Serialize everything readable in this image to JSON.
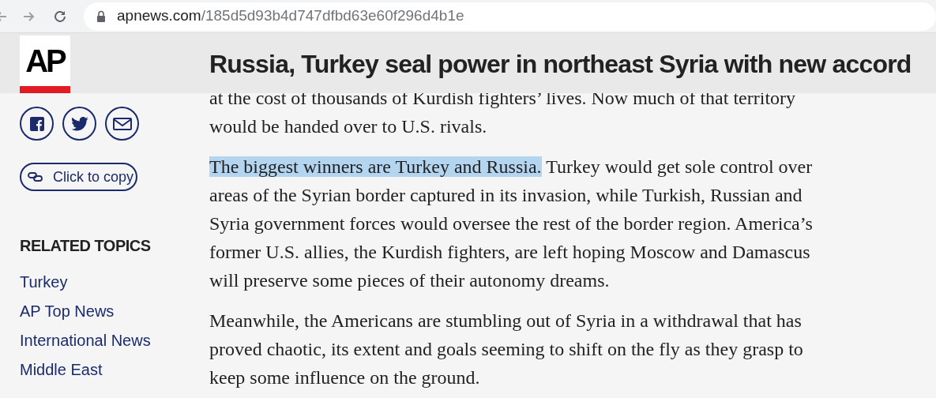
{
  "browser": {
    "domain": "apnews.com",
    "path": "/185d5d93b4d747dfbd63e60f296d4b1e"
  },
  "header": {
    "logo": "AP",
    "headline": "Russia, Turkey seal power in northeast Syria with new accord"
  },
  "share": {
    "copy_label": "Click to copy"
  },
  "related_topics": {
    "title": "RELATED TOPICS",
    "items": [
      "Turkey",
      "AP Top News",
      "International News",
      "Middle East"
    ]
  },
  "article": {
    "paragraphs": [
      {
        "text": "at the cost of thousands of Kurdish fighters’ lives. Now much of that territory would be handed over to U.S. rivals."
      },
      {
        "selected_text": "The biggest winners are Turkey and Russia.",
        "text": " Turkey would get sole control over areas of the Syrian border captured in its invasion, while Turkish, Russian and Syria government forces would oversee the rest of the border region. America’s former U.S. allies, the Kurdish fighters, are left hoping Moscow and Damascus will preserve some pieces of their autonomy dreams."
      },
      {
        "text": "Meanwhile, the Americans are stumbling out of Syria in a withdrawal that has proved chaotic, its extent and goals seeming to shift on the fly as they grasp to keep some influence on the ground."
      }
    ]
  }
}
